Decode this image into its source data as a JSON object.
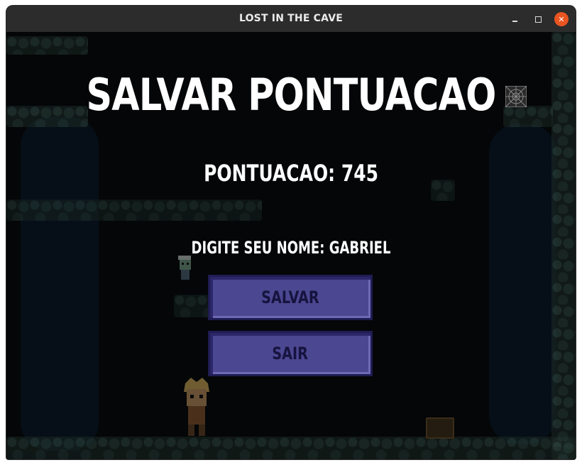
{
  "window": {
    "title": "LOST IN THE CAVE",
    "controls": [
      "minimize-icon",
      "maximize-icon",
      "close-icon"
    ],
    "close_color": "#e95420"
  },
  "screen": {
    "heading": "SALVAR PONTUACAO",
    "score_label": "PONTUACAO:",
    "score_value": "745",
    "name_prompt": "DIGITE SEU NOME:",
    "name_value": "GABRIEL"
  },
  "buttons": {
    "save_label": "SALVAR",
    "exit_label": "SAIR",
    "color": "#4b4791",
    "text_color": "#16133f"
  },
  "icons": [
    "spider-web-icon",
    "zombie-sprite-icon",
    "player-sprite-icon",
    "treasure-chest-icon"
  ]
}
